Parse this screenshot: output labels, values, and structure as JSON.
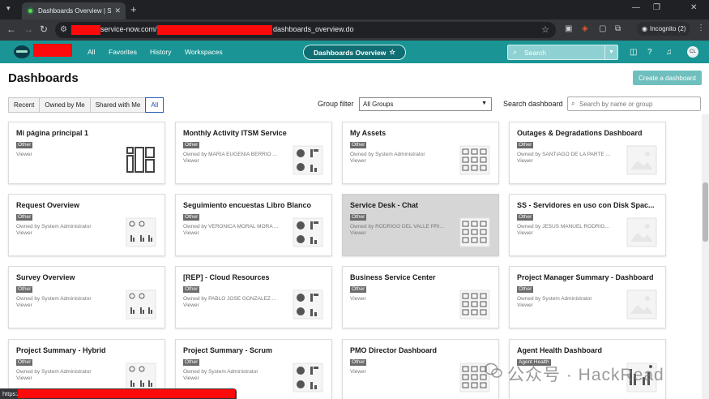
{
  "browser": {
    "tab_title": "Dashboards Overview | ServiceN",
    "url_domain": "service-now.com/n",
    "url_path": "dashboards_overview.do",
    "incognito": "Incognito (2)",
    "status_url": "https://"
  },
  "header": {
    "nav": [
      "All",
      "Favorites",
      "History",
      "Workspaces"
    ],
    "context_pill": "Dashboards Overview",
    "search_placeholder": "Search",
    "avatar_initials": "CL"
  },
  "page": {
    "title": "Dashboards",
    "create_button": "Create a dashboard",
    "filter_tabs": [
      "Recent",
      "Owned by Me",
      "Shared with Me",
      "All"
    ],
    "active_filter": "All",
    "group_filter_label": "Group filter",
    "group_filter_value": "All Groups",
    "search_label": "Search dashboard",
    "search_placeholder": "Search by name or group"
  },
  "cards": [
    {
      "title": "Mi página principal 1",
      "badge": "Other",
      "owner": "",
      "role": "Viewer",
      "thumb": "widgets-icon"
    },
    {
      "title": "Monthly Activity ITSM Service",
      "badge": "Other",
      "owner": "Owned by MARIA EUGENIA BERRIO ...",
      "role": "Viewer",
      "thumb": "chart-thumbnail"
    },
    {
      "title": "My Assets",
      "badge": "Other",
      "owner": "Owned by System Administrator",
      "role": "Viewer",
      "thumb": "chart-thumbnail"
    },
    {
      "title": "Outages & Degradations Dashboard",
      "badge": "Other",
      "owner": "Owned by SANTIAGO DE LA PARTE ...",
      "role": "Viewer",
      "thumb": "image-placeholder-icon"
    },
    {
      "title": "Request Overview",
      "badge": "Other",
      "owner": "Owned by System Administrator",
      "role": "Viewer",
      "thumb": "chart-thumbnail"
    },
    {
      "title": "Seguimiento encuestas Libro Blanco",
      "badge": "Other",
      "owner": "Owned by VERONICA MORAL MORA ...",
      "role": "Viewer",
      "thumb": "chart-thumbnail"
    },
    {
      "title": "Service Desk - Chat",
      "badge": "Other",
      "owner": "Owned by RODRIGO DEL VALLE PRI...",
      "role": "Viewer",
      "thumb": "chart-thumbnail"
    },
    {
      "title": "SS - Servidores en uso con Disk Spac...",
      "badge": "Other",
      "owner": "Owned by JESUS MANUEL RODRIG...",
      "role": "Viewer",
      "thumb": "image-placeholder-icon"
    },
    {
      "title": "Survey Overview",
      "badge": "Other",
      "owner": "Owned by System Administrator",
      "role": "Viewer",
      "thumb": "chart-thumbnail"
    },
    {
      "title": "[REP] - Cloud Resources",
      "badge": "Other",
      "owner": "Owned by PABLO JOSE GONZALEZ ...",
      "role": "Viewer",
      "thumb": "chart-thumbnail"
    },
    {
      "title": "Business Service Center",
      "badge": "Other",
      "owner": "",
      "role": "Viewer",
      "thumb": "chart-thumbnail"
    },
    {
      "title": "Project Manager Summary - Dashboard",
      "badge": "Other",
      "owner": "Owned by System Administrator",
      "role": "Viewer",
      "thumb": "image-placeholder-icon"
    },
    {
      "title": "Project Summary - Hybrid",
      "badge": "Other",
      "owner": "Owned by System Administrator",
      "role": "Viewer",
      "thumb": "chart-thumbnail"
    },
    {
      "title": "Project Summary - Scrum",
      "badge": "Other",
      "owner": "Owned by System Administrator",
      "role": "Viewer",
      "thumb": "chart-thumbnail"
    },
    {
      "title": "PMO Director Dashboard",
      "badge": "Other",
      "owner": "",
      "role": "Viewer",
      "thumb": "chart-thumbnail"
    },
    {
      "title": "Agent Health Dashboard",
      "badge": "Agent Health",
      "owner": "",
      "role": "",
      "thumb": "chart-thumbnail"
    }
  ],
  "watermark": "公众号 · HackRead",
  "colors": {
    "brand": "#1a9494",
    "button": "#6ebfbd",
    "redaction": "#ff0a0a",
    "active_tab": "#2b5fb5"
  }
}
